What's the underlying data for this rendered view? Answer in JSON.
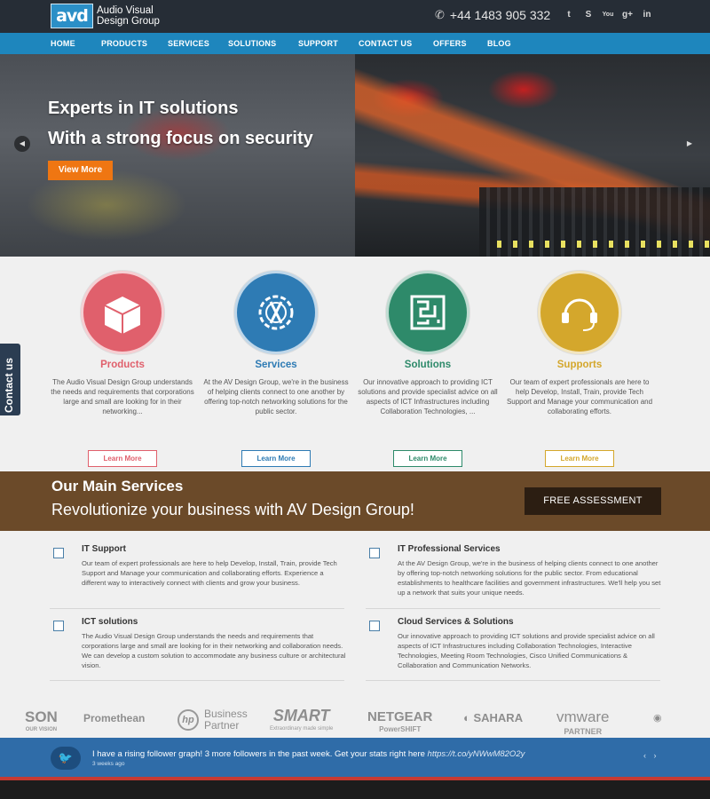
{
  "header": {
    "logo_mark": "avd",
    "logo_line1": "Audio Visual",
    "logo_line2": "Design Group",
    "phone": "+44 1483 905 332",
    "social": [
      "twitter-icon",
      "skype-icon",
      "youtube-icon",
      "google-plus-icon",
      "linkedin-icon"
    ],
    "social_glyphs": [
      "t",
      "S",
      "You",
      "g+",
      "in"
    ]
  },
  "nav": {
    "items": [
      "HOME",
      "PRODUCTS",
      "SERVICES",
      "SOLUTIONS",
      "SUPPORT",
      "CONTACT US",
      "OFFERS",
      "BLOG"
    ]
  },
  "hero": {
    "line1": "Experts in IT solutions",
    "line2": "With a strong focus on security",
    "button": "View More",
    "prev": "◀",
    "next": "▶"
  },
  "features": [
    {
      "title": "Products",
      "color": "#e0606c",
      "desc": "The Audio Visual Design Group understands the needs and requirements that corporations large and small are looking for in their networking...",
      "button": "Learn More"
    },
    {
      "title": "Services",
      "color": "#2e7bb4",
      "desc": "At the AV Design Group, we're in the business of helping clients connect to one another by offering top-notch networking solutions for the public sector.",
      "button": "Learn More"
    },
    {
      "title": "Solutions",
      "color": "#2e8a6a",
      "desc": "Our innovative approach to providing ICT solutions and provide specialist advice on all aspects of ICT Infrastructures including Collaboration Technologies, ...",
      "button": "Learn More"
    },
    {
      "title": "Supports",
      "color": "#d4a72c",
      "desc": "Our team of expert professionals are here to help Develop, Install, Train, provide Tech Support and Manage your communication and collaborating efforts.",
      "button": "Learn More"
    }
  ],
  "contact_tab": "Contact us",
  "band": {
    "title": "Our Main Services",
    "subtitle": "Revolutionize your business with AV Design Group!",
    "button": "FREE ASSESSMENT"
  },
  "services": [
    {
      "title": "IT Support",
      "desc": "Our team of expert professionals are here to help Develop, Install, Train, provide Tech Support and Manage your communication and collaborating efforts. Experience a different way to interactively connect with clients and grow your business."
    },
    {
      "title": "IT Professional Services",
      "desc": "At the AV Design Group, we're in the business of helping clients connect to one another by offering top-notch networking solutions for the public sector. From educational establishments to healthcare facilities and government infrastructures. We'll help you set up a network that suits your unique needs."
    },
    {
      "title": "ICT solutions",
      "desc": "The Audio Visual Design Group understands the needs and requirements that corporations large and small are looking for in their networking and collaboration needs. We can develop a custom solution to accommodate any business culture or architectural vision."
    },
    {
      "title": "Cloud Services & Solutions",
      "desc": "Our innovative approach to providing ICT solutions and provide specialist advice on all aspects of ICT Infrastructures including Collaboration Technologies, Interactive Technologies, Meeting Room Technologies, Cisco Unified Communications & Collaboration and Communication Networks."
    }
  ],
  "partners": [
    {
      "name": "SON",
      "sub": "OUR VISION"
    },
    {
      "name": "Promethean",
      "sub": ""
    },
    {
      "name": "Business Partner",
      "sub": ""
    },
    {
      "name": "SMART",
      "sub": "Extraordinary made simple"
    },
    {
      "name": "NETGEAR",
      "sub": "PowerSHIFT"
    },
    {
      "name": "SAHARA",
      "sub": ""
    },
    {
      "name": "vmware",
      "sub": "PARTNER"
    }
  ],
  "twitter": {
    "text": "I have a rising follower graph! 3 more followers in the past week. Get your stats right here ",
    "link": "https://t.co/yNWwM82O2y",
    "time": "3 weeks ago",
    "nav": "‹ ›"
  }
}
